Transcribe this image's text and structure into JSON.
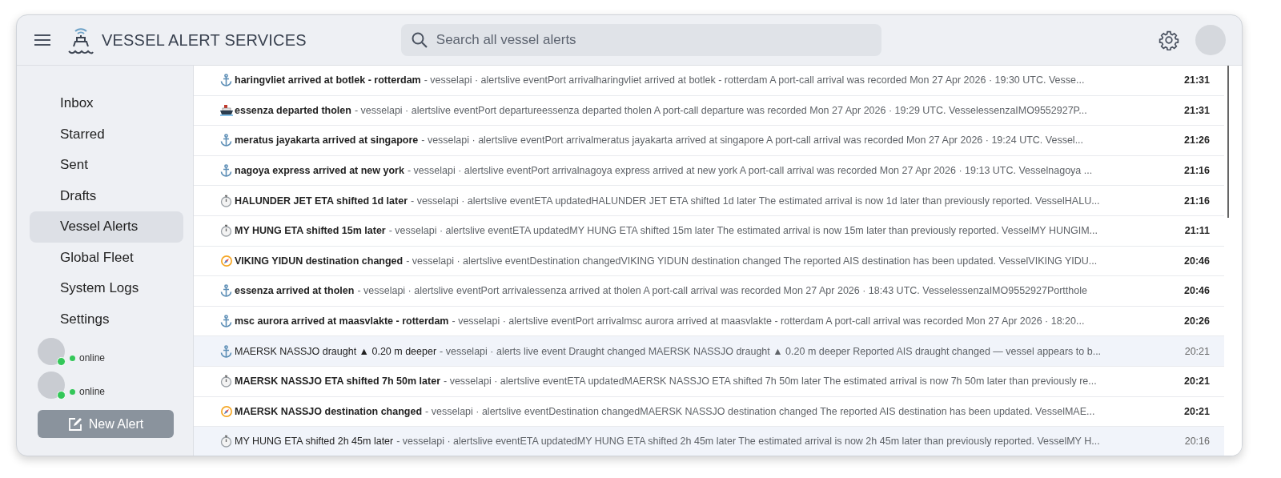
{
  "app": {
    "title": "VESSEL ALERT SERVICES"
  },
  "search": {
    "placeholder": "Search all vessel alerts"
  },
  "sidebar": {
    "items": [
      {
        "label": "Inbox",
        "selected": false
      },
      {
        "label": "Starred",
        "selected": false
      },
      {
        "label": "Sent",
        "selected": false
      },
      {
        "label": "Drafts",
        "selected": false
      },
      {
        "label": "Vessel Alerts",
        "selected": true
      },
      {
        "label": "Global Fleet",
        "selected": false
      },
      {
        "label": "System Logs",
        "selected": false
      },
      {
        "label": "Settings",
        "selected": false
      }
    ],
    "users": [
      {
        "status": "online"
      },
      {
        "status": "online"
      }
    ],
    "new_button": "New Alert"
  },
  "alerts": [
    {
      "kind": "arrival",
      "unread": true,
      "subject": "haringvliet arrived at botlek - rotterdam",
      "snippet": "- vesselapi · alertslive eventPort arrivalharingvliet arrived at botlek - rotterdam A port-call arrival was recorded Mon 27 Apr 2026 · 19:30 UTC. Vesse...",
      "time": "21:31"
    },
    {
      "kind": "departure",
      "unread": true,
      "subject": "essenza departed tholen",
      "snippet": "- vesselapi · alertslive eventPort departureessenza departed tholen A port-call departure was recorded Mon 27 Apr 2026 · 19:29 UTC. VesselessenzaIMO9552927P...",
      "time": "21:31"
    },
    {
      "kind": "arrival",
      "unread": true,
      "subject": "meratus jayakarta arrived at singapore",
      "snippet": "- vesselapi · alertslive eventPort arrivalmeratus jayakarta arrived at singapore A port-call arrival was recorded Mon 27 Apr 2026 · 19:24 UTC. Vessel...",
      "time": "21:26"
    },
    {
      "kind": "arrival",
      "unread": true,
      "subject": "nagoya express arrived at new york",
      "snippet": "- vesselapi · alertslive eventPort arrivalnagoya express arrived at new york A port-call arrival was recorded Mon 27 Apr 2026 · 19:13 UTC. Vesselnagoya ...",
      "time": "21:16"
    },
    {
      "kind": "eta",
      "unread": true,
      "subject": "HALUNDER JET ETA shifted 1d later",
      "snippet": "- vesselapi · alertslive eventETA updatedHALUNDER JET ETA shifted 1d later The estimated arrival is now 1d later than previously reported. VesselHALU...",
      "time": "21:16"
    },
    {
      "kind": "eta",
      "unread": true,
      "subject": "MY HUNG ETA shifted 15m later",
      "snippet": "- vesselapi · alertslive eventETA updatedMY HUNG ETA shifted 15m later The estimated arrival is now 15m later than previously reported. VesselMY HUNGIM...",
      "time": "21:11"
    },
    {
      "kind": "destination",
      "unread": true,
      "subject": "VIKING YIDUN destination changed",
      "snippet": "- vesselapi · alertslive eventDestination changedVIKING YIDUN destination changed The reported AIS destination has been updated. VesselVIKING YIDU...",
      "time": "20:46"
    },
    {
      "kind": "arrival",
      "unread": true,
      "subject": "essenza arrived at tholen",
      "snippet": "- vesselapi · alertslive eventPort arrivalessenza arrived at tholen A port-call arrival was recorded Mon 27 Apr 2026 · 18:43 UTC. VesselessenzaIMO9552927Portthole",
      "time": "20:46"
    },
    {
      "kind": "arrival",
      "unread": true,
      "subject": "msc aurora arrived at maasvlakte - rotterdam",
      "snippet": "- vesselapi · alertslive eventPort arrivalmsc aurora arrived at maasvlakte - rotterdam A port-call arrival was recorded Mon 27 Apr 2026 · 18:20...",
      "time": "20:26"
    },
    {
      "kind": "arrival",
      "unread": false,
      "subject": "MAERSK NASSJO draught ▲ 0.20 m deeper",
      "snippet": "- vesselapi · alerts live event Draught changed MAERSK NASSJO draught ▲ 0.20 m deeper Reported AIS draught changed — vessel appears to b...",
      "time": "20:21"
    },
    {
      "kind": "eta",
      "unread": true,
      "subject": "MAERSK NASSJO ETA shifted 7h 50m later",
      "snippet": "- vesselapi · alertslive eventETA updatedMAERSK NASSJO ETA shifted 7h 50m later The estimated arrival is now 7h 50m later than previously re...",
      "time": "20:21"
    },
    {
      "kind": "destination",
      "unread": true,
      "subject": "MAERSK NASSJO destination changed",
      "snippet": "- vesselapi · alertslive eventDestination changedMAERSK NASSJO destination changed The reported AIS destination has been updated. VesselMAE...",
      "time": "20:21"
    },
    {
      "kind": "eta",
      "unread": false,
      "subject": "MY HUNG ETA shifted 2h 45m later",
      "snippet": "- vesselapi · alertslive eventETA updatedMY HUNG ETA shifted 2h 45m later The estimated arrival is now 2h 45m later than previously reported. VesselMY H...",
      "time": "20:16"
    }
  ]
}
